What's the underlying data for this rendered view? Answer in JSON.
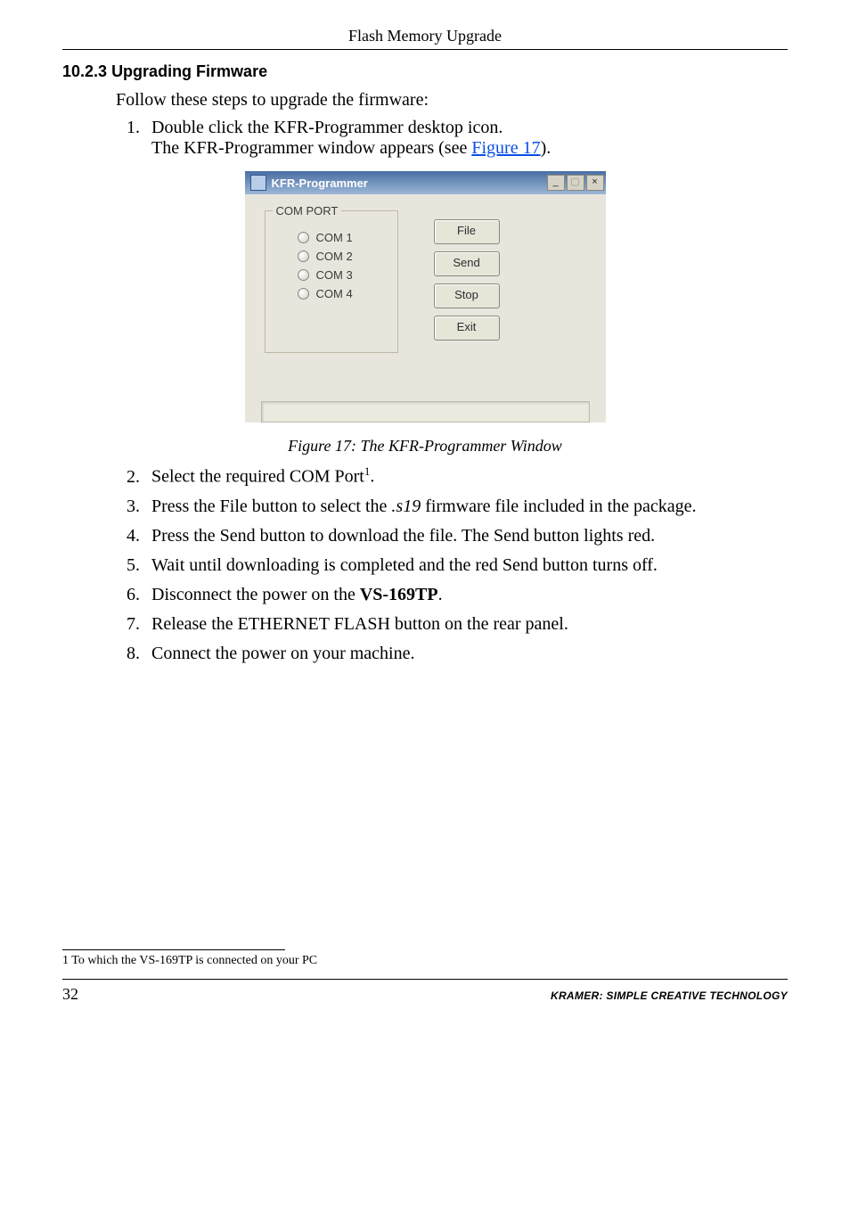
{
  "header": {
    "title": "Flash Memory Upgrade"
  },
  "section": {
    "num": "10.2.3",
    "title": "Upgrading Firmware",
    "intro": "Follow these steps to upgrade the firmware:"
  },
  "steps_a": [
    {
      "line1": "Double click the KFR-Programmer desktop icon.",
      "line2_a": "The KFR-Programmer window appears (see ",
      "link": "Figure 17",
      "line2_b": ")."
    }
  ],
  "dialog": {
    "title": "KFR-Programmer",
    "group_label": "COM PORT",
    "radios": [
      "COM 1",
      "COM 2",
      "COM 3",
      "COM 4"
    ],
    "buttons": {
      "file": "File",
      "send": "Send",
      "stop": "Stop",
      "exit": "Exit"
    }
  },
  "figure_caption": "Figure 17: The KFR-Programmer Window",
  "steps_b": {
    "2_a": "Select the required COM Port",
    "2_sup": "1",
    "2_b": ".",
    "3_a": "Press the File button to select the ",
    "3_it": ".s19",
    "3_b": " firmware file included in the package.",
    "4": "Press the Send button to download the file. The Send button lights red.",
    "5": "Wait until downloading is completed and the red Send button turns off.",
    "6_a": "Disconnect the power on the ",
    "6_bold": "VS-169TP",
    "6_b": ".",
    "7": "Release the ETHERNET FLASH button on the rear panel.",
    "8": "Connect the power on your machine."
  },
  "footnote": "1 To which the VS-169TP is connected on your PC",
  "footer": {
    "page": "32",
    "brand": "KRAMER:  SIMPLE CREATIVE TECHNOLOGY"
  }
}
